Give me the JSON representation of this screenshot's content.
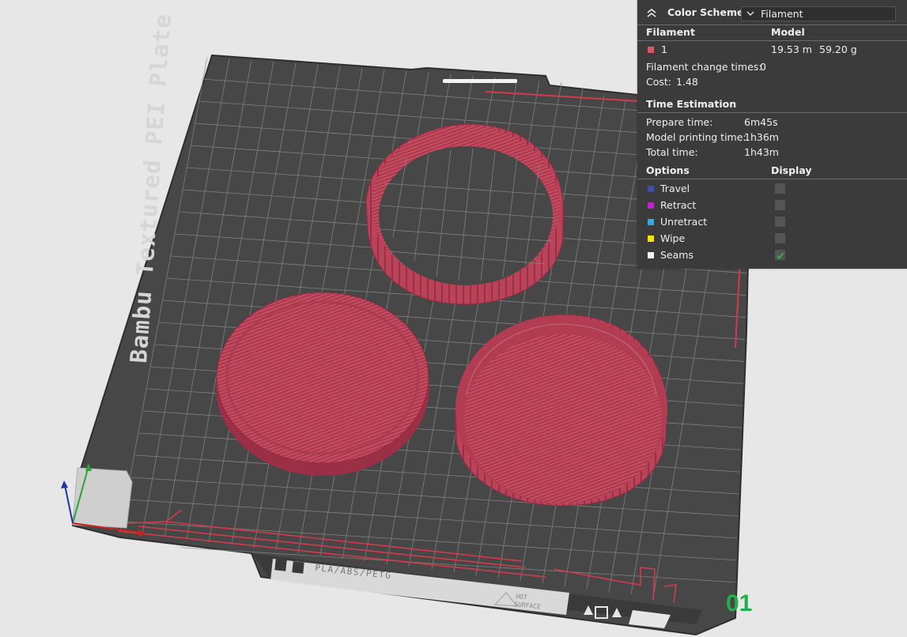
{
  "plate": {
    "label": "Bambu Textured PEI Plate",
    "material_text": "PLA/ABS/PETG",
    "hot_surface_line1": "HOT",
    "hot_surface_line2": "SURFACE",
    "plate_number": "01"
  },
  "colors": {
    "background": "#e7e7e7",
    "bed": "#474747",
    "model": "#c24a5f",
    "panel": "#3b3b3b",
    "plate_number": "#23b04a"
  },
  "panel": {
    "color_scheme_label": "Color Scheme",
    "color_scheme_value": "Filament",
    "filament_header": "Filament",
    "model_header": "Model",
    "filament_row": {
      "index": "1",
      "length": "19.53 m",
      "weight": "59.20 g",
      "color": "#e05566"
    },
    "filament_change_times_label": "Filament change times:",
    "filament_change_times_value": "0",
    "cost_label": "Cost:",
    "cost_value": "1.48",
    "time_estimation_header": "Time Estimation",
    "times": [
      {
        "label": "Prepare time:",
        "value": "6m45s"
      },
      {
        "label": "Model printing time:",
        "value": "1h36m"
      },
      {
        "label": "Total time:",
        "value": "1h43m"
      }
    ],
    "options_header": "Options",
    "display_header": "Display",
    "options": [
      {
        "label": "Travel",
        "color": "#3d4fa8",
        "checked": false
      },
      {
        "label": "Retract",
        "color": "#c026c7",
        "checked": false
      },
      {
        "label": "Unretract",
        "color": "#3aa7d6",
        "checked": false
      },
      {
        "label": "Wipe",
        "color": "#f2e600",
        "checked": false
      },
      {
        "label": "Seams",
        "color": "#f2f2f2",
        "checked": true
      }
    ]
  }
}
